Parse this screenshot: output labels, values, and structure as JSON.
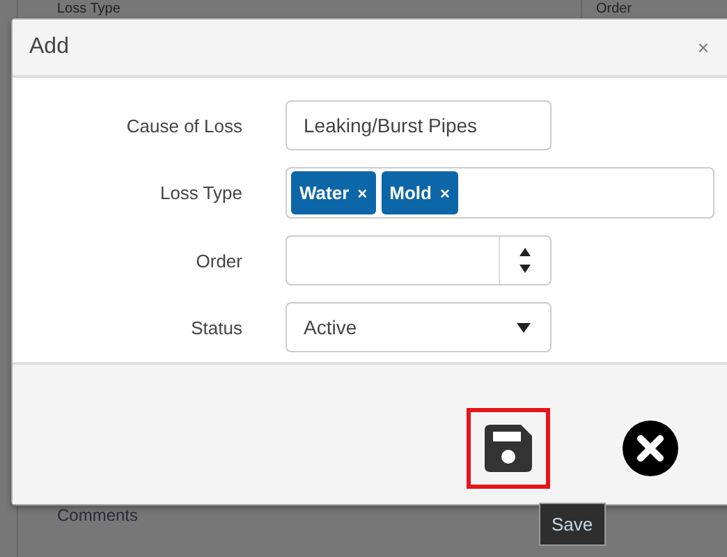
{
  "background_table": {
    "columns": [
      "Loss Type",
      "Order"
    ],
    "rows": [
      "Comments"
    ]
  },
  "dialog": {
    "title": "Add",
    "close": "×",
    "fields": [
      {
        "kind": "text",
        "label": "Cause of Loss",
        "value": "Leaking/Burst Pipes"
      },
      {
        "kind": "tags",
        "label": "Loss Type",
        "tags": [
          {
            "text": "Water",
            "remove": "×"
          },
          {
            "text": "Mold",
            "remove": "×"
          }
        ]
      },
      {
        "kind": "number",
        "label": "Order"
      },
      {
        "kind": "select",
        "label": "Status",
        "value": "Active"
      }
    ],
    "buttons": [
      {
        "kind": "save",
        "focused": true
      },
      {
        "kind": "cancel",
        "focused": false
      }
    ]
  },
  "tooltip": "Save"
}
